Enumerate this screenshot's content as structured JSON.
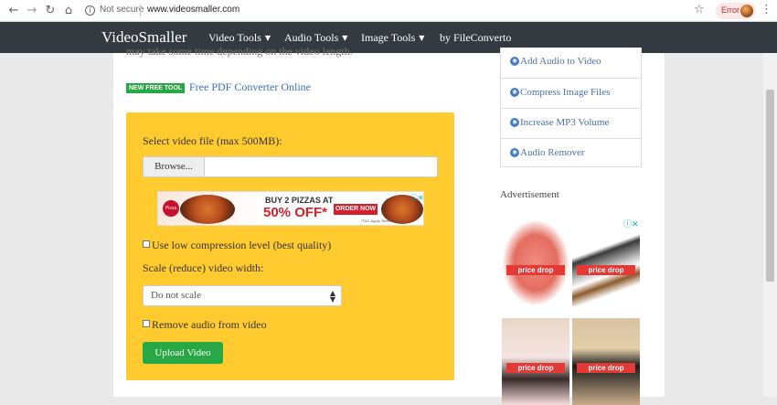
{
  "browser": {
    "back_icon": "←",
    "forward_icon": "→",
    "reload_icon": "↻",
    "home_icon": "⌂",
    "security_label": "Not secure",
    "url": "www.videosmaller.com",
    "star_icon": "☆",
    "profile_status": "Error",
    "menu_icon": "⋮"
  },
  "nav": {
    "brand": "VideoSmaller",
    "items": [
      {
        "label": "Video Tools",
        "has_dropdown": true
      },
      {
        "label": "Audio Tools",
        "has_dropdown": true
      },
      {
        "label": "Image Tools",
        "has_dropdown": true
      },
      {
        "label": "by FileConverto",
        "has_dropdown": false
      }
    ],
    "caret": "▼"
  },
  "main": {
    "truncated_text": "may take some time depending on the video length.",
    "badge": "NEW FREE TOOL",
    "free_tool_link": "Free PDF Converter Online",
    "form": {
      "file_label": "Select video file (max 500MB):",
      "browse_label": "Browse...",
      "low_compression_label": "Use low compression level (best quality)",
      "scale_label": "Scale (reduce) video width:",
      "scale_selected": "Do not scale",
      "remove_audio_label": "Remove audio from video",
      "upload_label": "Upload Video"
    },
    "ad": {
      "brand": "Pizza Hut",
      "headline": "BUY 2 PIZZAS AT",
      "offer": "50% OFF*",
      "cta": "ORDER NOW",
      "fine_print": "*T&C Apply. Refer website.",
      "info_icon": "ⓘ✕"
    }
  },
  "sidebar": {
    "links": [
      "Add Audio to Video",
      "Compress Image Files",
      "Increase MP3 Volume",
      "Audio Remover"
    ],
    "globe_icon": "◉",
    "advertisement_title": "Advertisement",
    "ad_choices_icon": "ⓘ✕",
    "products": [
      {
        "badge": "price drop"
      },
      {
        "badge": "price drop"
      },
      {
        "badge": "price drop"
      },
      {
        "badge": "price drop"
      }
    ]
  },
  "colors": {
    "nav_bg": "#343a40",
    "panel_bg": "#ffcb2f",
    "upload_btn": "#28a745",
    "link": "#3b6fb6"
  }
}
